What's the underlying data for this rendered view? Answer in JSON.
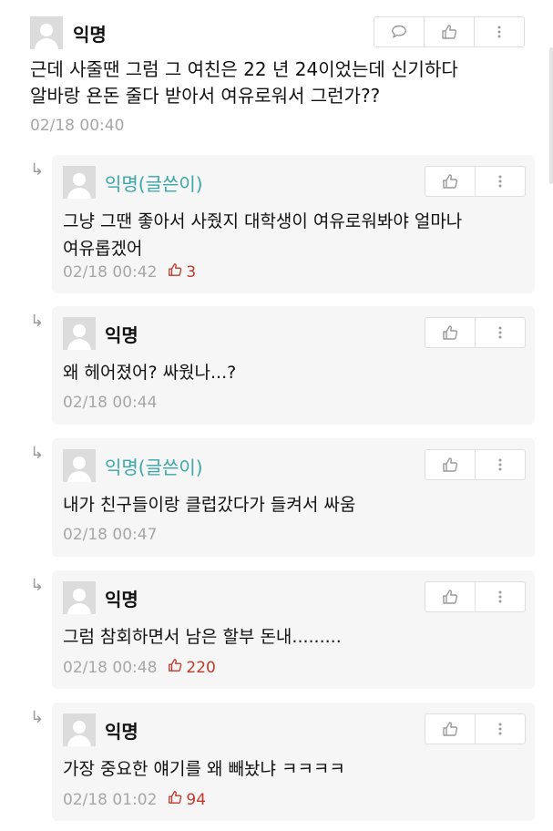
{
  "icons": {
    "comment": "speech-bubble-icon",
    "like": "thumbs-up-icon",
    "more": "vertical-dots-icon",
    "reply": "reply-arrow-icon"
  },
  "colors": {
    "op_author": "#3aa6a8",
    "like_count": "#c0392b",
    "reply_card": "#f6f6f6",
    "meta": "#a6a6a6"
  },
  "top_comment": {
    "author": "익명",
    "text_line1": "근데 사줄땐 그럼 그 여친은 22 년 24이었는데 신기하다",
    "text_line2": "알바랑 욘돈 줄다 받아서 여유로워서 그런가??",
    "time": "02/18 00:40"
  },
  "replies": [
    {
      "author": "익명(글쓴이)",
      "is_op": true,
      "text_line1": "그냥 그땐 좋아서 사줬지 대학생이 여유로워봐야 얼마나",
      "text_line2": "여유롭겠어",
      "time": "02/18 00:42",
      "likes": "3"
    },
    {
      "author": "익명",
      "is_op": false,
      "text_line1": "왜 헤어졌어? 싸웠나...?",
      "time": "02/18 00:44"
    },
    {
      "author": "익명(글쓴이)",
      "is_op": true,
      "text_line1": "내가 친구들이랑 클럽갔다가 들켜서 싸움",
      "time": "02/18 00:47"
    },
    {
      "author": "익명",
      "is_op": false,
      "text_line1": "그럼 참회하면서 남은 할부 돈내.........",
      "time": "02/18 00:48",
      "likes": "220"
    },
    {
      "author": "익명",
      "is_op": false,
      "text_line1": "가장 중요한 얘기를 왜 빼놨냐 ㅋㅋㅋㅋ",
      "time": "02/18 01:02",
      "likes": "94"
    }
  ]
}
